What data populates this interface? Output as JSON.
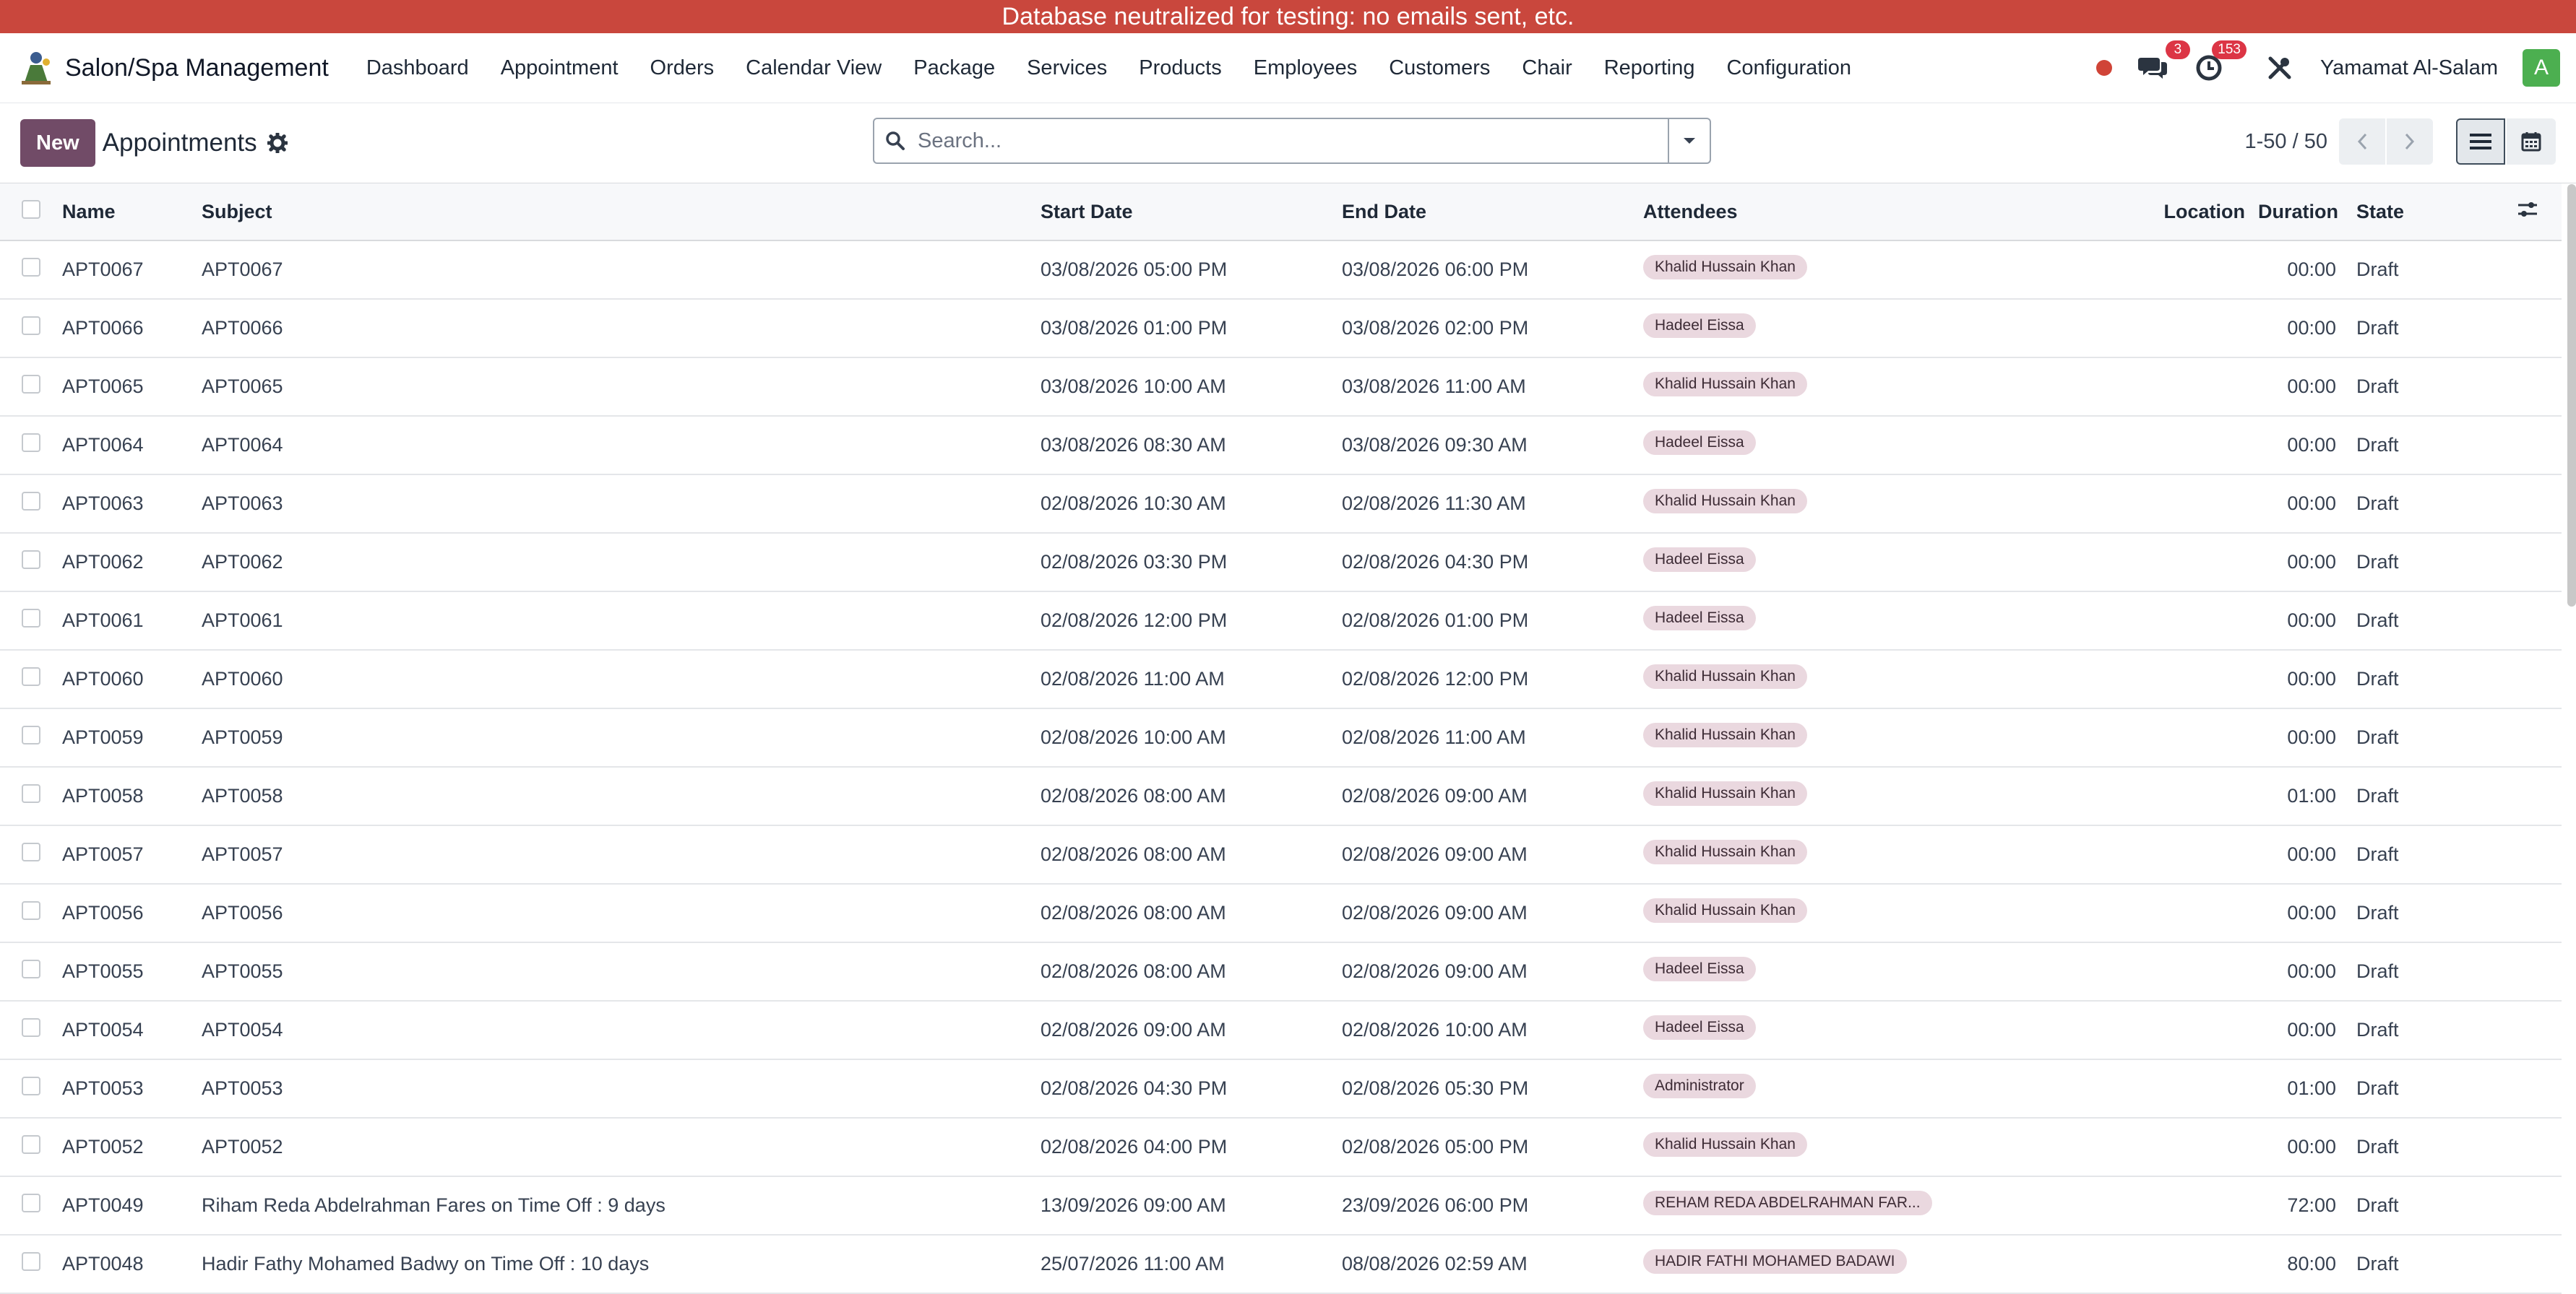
{
  "banner": {
    "text": "Database neutralized for testing: no emails sent, etc."
  },
  "navbar": {
    "app_name": "Salon/Spa Management",
    "menu": [
      "Dashboard",
      "Appointment",
      "Orders",
      "Calendar View",
      "Package",
      "Services",
      "Products",
      "Employees",
      "Customers",
      "Chair",
      "Reporting",
      "Configuration"
    ],
    "messages_count": "3",
    "activities_count": "153",
    "user_name": "Yamamat Al-Salam",
    "avatar_letter": "A",
    "colors": {
      "banner": "#c9473d",
      "avatar": "#4caf50",
      "badge": "#dc3545",
      "status_dot": "#d04437"
    }
  },
  "control_panel": {
    "new_label": "New",
    "title": "Appointments",
    "search_placeholder": "Search...",
    "pager": "1-50 / 50",
    "accent_color": "#714b67"
  },
  "table": {
    "headers": {
      "name": "Name",
      "subject": "Subject",
      "start": "Start Date",
      "end": "End Date",
      "attendees": "Attendees",
      "location": "Location",
      "duration": "Duration",
      "state": "State"
    },
    "rows": [
      {
        "name": "APT0067",
        "subject": "APT0067",
        "start": "03/08/2026 05:00 PM",
        "end": "03/08/2026 06:00 PM",
        "attendee": "Khalid Hussain Khan",
        "location": "",
        "duration": "00:00",
        "state": "Draft"
      },
      {
        "name": "APT0066",
        "subject": "APT0066",
        "start": "03/08/2026 01:00 PM",
        "end": "03/08/2026 02:00 PM",
        "attendee": "Hadeel Eissa",
        "location": "",
        "duration": "00:00",
        "state": "Draft"
      },
      {
        "name": "APT0065",
        "subject": "APT0065",
        "start": "03/08/2026 10:00 AM",
        "end": "03/08/2026 11:00 AM",
        "attendee": "Khalid Hussain Khan",
        "location": "",
        "duration": "00:00",
        "state": "Draft"
      },
      {
        "name": "APT0064",
        "subject": "APT0064",
        "start": "03/08/2026 08:30 AM",
        "end": "03/08/2026 09:30 AM",
        "attendee": "Hadeel Eissa",
        "location": "",
        "duration": "00:00",
        "state": "Draft"
      },
      {
        "name": "APT0063",
        "subject": "APT0063",
        "start": "02/08/2026 10:30 AM",
        "end": "02/08/2026 11:30 AM",
        "attendee": "Khalid Hussain Khan",
        "location": "",
        "duration": "00:00",
        "state": "Draft"
      },
      {
        "name": "APT0062",
        "subject": "APT0062",
        "start": "02/08/2026 03:30 PM",
        "end": "02/08/2026 04:30 PM",
        "attendee": "Hadeel Eissa",
        "location": "",
        "duration": "00:00",
        "state": "Draft"
      },
      {
        "name": "APT0061",
        "subject": "APT0061",
        "start": "02/08/2026 12:00 PM",
        "end": "02/08/2026 01:00 PM",
        "attendee": "Hadeel Eissa",
        "location": "",
        "duration": "00:00",
        "state": "Draft"
      },
      {
        "name": "APT0060",
        "subject": "APT0060",
        "start": "02/08/2026 11:00 AM",
        "end": "02/08/2026 12:00 PM",
        "attendee": "Khalid Hussain Khan",
        "location": "",
        "duration": "00:00",
        "state": "Draft"
      },
      {
        "name": "APT0059",
        "subject": "APT0059",
        "start": "02/08/2026 10:00 AM",
        "end": "02/08/2026 11:00 AM",
        "attendee": "Khalid Hussain Khan",
        "location": "",
        "duration": "00:00",
        "state": "Draft"
      },
      {
        "name": "APT0058",
        "subject": "APT0058",
        "start": "02/08/2026 08:00 AM",
        "end": "02/08/2026 09:00 AM",
        "attendee": "Khalid Hussain Khan",
        "location": "",
        "duration": "01:00",
        "state": "Draft"
      },
      {
        "name": "APT0057",
        "subject": "APT0057",
        "start": "02/08/2026 08:00 AM",
        "end": "02/08/2026 09:00 AM",
        "attendee": "Khalid Hussain Khan",
        "location": "",
        "duration": "00:00",
        "state": "Draft"
      },
      {
        "name": "APT0056",
        "subject": "APT0056",
        "start": "02/08/2026 08:00 AM",
        "end": "02/08/2026 09:00 AM",
        "attendee": "Khalid Hussain Khan",
        "location": "",
        "duration": "00:00",
        "state": "Draft"
      },
      {
        "name": "APT0055",
        "subject": "APT0055",
        "start": "02/08/2026 08:00 AM",
        "end": "02/08/2026 09:00 AM",
        "attendee": "Hadeel Eissa",
        "location": "",
        "duration": "00:00",
        "state": "Draft"
      },
      {
        "name": "APT0054",
        "subject": "APT0054",
        "start": "02/08/2026 09:00 AM",
        "end": "02/08/2026 10:00 AM",
        "attendee": "Hadeel Eissa",
        "location": "",
        "duration": "00:00",
        "state": "Draft"
      },
      {
        "name": "APT0053",
        "subject": "APT0053",
        "start": "02/08/2026 04:30 PM",
        "end": "02/08/2026 05:30 PM",
        "attendee": "Administrator",
        "location": "",
        "duration": "01:00",
        "state": "Draft"
      },
      {
        "name": "APT0052",
        "subject": "APT0052",
        "start": "02/08/2026 04:00 PM",
        "end": "02/08/2026 05:00 PM",
        "attendee": "Khalid Hussain Khan",
        "location": "",
        "duration": "00:00",
        "state": "Draft"
      },
      {
        "name": "APT0049",
        "subject": "Riham Reda Abdelrahman Fares on Time Off : 9 days",
        "start": "13/09/2026 09:00 AM",
        "end": "23/09/2026 06:00 PM",
        "attendee": "REHAM REDA ABDELRAHMAN FAR...",
        "location": "",
        "duration": "72:00",
        "state": "Draft"
      },
      {
        "name": "APT0048",
        "subject": "Hadir Fathy Mohamed Badwy on Time Off : 10 days",
        "start": "25/07/2026 11:00 AM",
        "end": "08/08/2026 02:59 AM",
        "attendee": "HADIR FATHI MOHAMED BADAWI",
        "location": "",
        "duration": "80:00",
        "state": "Draft"
      }
    ]
  }
}
